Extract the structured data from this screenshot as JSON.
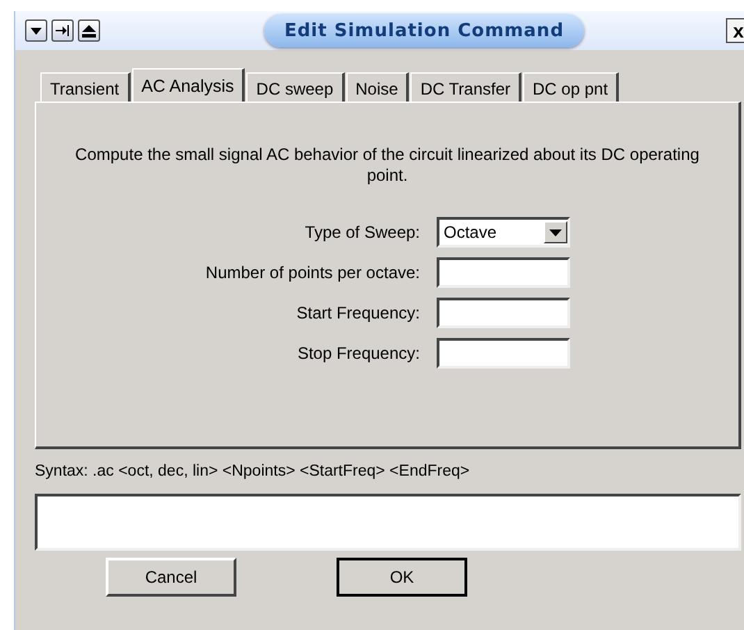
{
  "window": {
    "title": "Edit Simulation Command",
    "close_glyph": "x"
  },
  "tabs": [
    {
      "label": "Transient",
      "selected": false
    },
    {
      "label": "AC Analysis",
      "selected": true
    },
    {
      "label": "DC sweep",
      "selected": false
    },
    {
      "label": "Noise",
      "selected": false
    },
    {
      "label": "DC Transfer",
      "selected": false
    },
    {
      "label": "DC op pnt",
      "selected": false
    }
  ],
  "description": "Compute the small signal AC behavior of the circuit linearized about its DC operating point.",
  "fields": [
    {
      "kind": "dropdown",
      "label": "Type of Sweep:",
      "value": "Octave"
    },
    {
      "kind": "text",
      "label": "Number of points per octave:"
    },
    {
      "kind": "text",
      "label": "Start Frequency:"
    },
    {
      "kind": "text",
      "label": "Stop Frequency:"
    }
  ],
  "syntax": "Syntax:  .ac <oct, dec, lin> <Npoints> <StartFreq> <EndFreq>",
  "buttons": [
    {
      "label": "Cancel",
      "default": false
    },
    {
      "label": "OK",
      "default": true
    }
  ]
}
